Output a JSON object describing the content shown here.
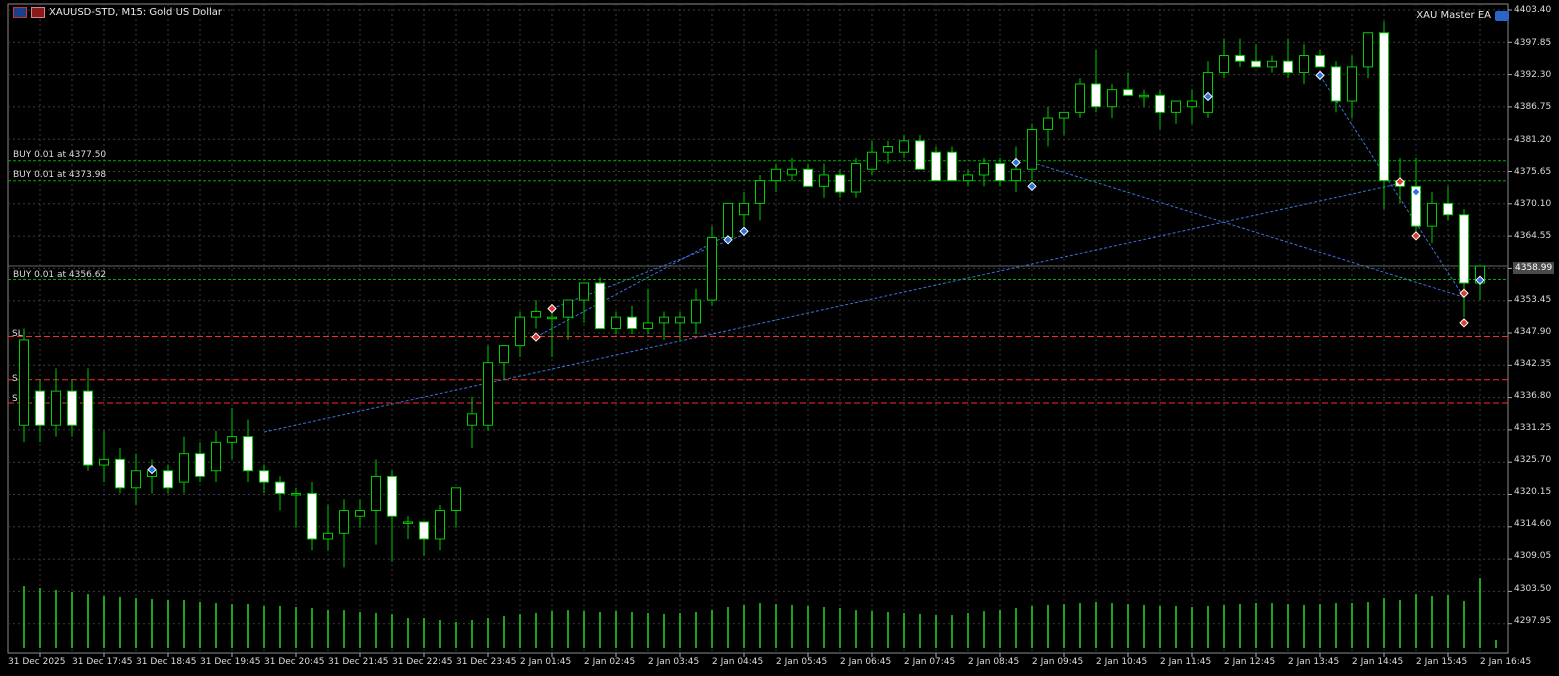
{
  "window": {
    "symbol_title": "XAUUSD-STD, M15:  Gold US Dollar",
    "expert_label": "XAU Master EA",
    "icons": [
      "chart-menu-icon",
      "instrument-icon",
      "expert-cap-icon"
    ]
  },
  "orders": [
    {
      "label": "BUY 0.01 at 4377.50",
      "price": 4377.5
    },
    {
      "label": "BUY 0.01 at 4373.98",
      "price": 4373.98
    },
    {
      "label": "BUY 0.01 at 4356.62",
      "price": 4356.62
    }
  ],
  "sl_markers": [
    {
      "label": "SL",
      "price": 4346.6
    },
    {
      "label": "S",
      "price": 4339.0
    },
    {
      "label": "S",
      "price": 4334.9
    }
  ],
  "current_price": "4358.99",
  "colors": {
    "background": "#000000",
    "grid": "#3d3d3d",
    "bull_candle": "#000000",
    "bear_candle": "#ffffff",
    "wick": "#00cc00",
    "volume": "#22cc22",
    "order_line": "#00aa00",
    "sl_line": "#ff2a2a",
    "trade_line": "#3b73d9"
  },
  "y_axis": [
    "4403.40",
    "4397.85",
    "4392.30",
    "4386.75",
    "4381.20",
    "4375.65",
    "4370.10",
    "4364.55",
    "4358.99",
    "4353.45",
    "4347.90",
    "4342.35",
    "4336.80",
    "4331.25",
    "4325.70",
    "4320.15",
    "4314.60",
    "4309.05",
    "4303.50",
    "4297.95"
  ],
  "x_axis": [
    "31 Dec 2025",
    "31 Dec 17:45",
    "31 Dec 18:45",
    "31 Dec 19:45",
    "31 Dec 20:45",
    "31 Dec 21:45",
    "31 Dec 22:45",
    "31 Dec 23:45",
    "2 Jan 01:45",
    "2 Jan 02:45",
    "2 Jan 03:45",
    "2 Jan 04:45",
    "2 Jan 05:45",
    "2 Jan 06:45",
    "2 Jan 07:45",
    "2 Jan 08:45",
    "2 Jan 09:45",
    "2 Jan 10:45",
    "2 Jan 11:45",
    "2 Jan 12:45",
    "2 Jan 13:45",
    "2 Jan 14:45",
    "2 Jan 15:45",
    "2 Jan 16:45"
  ],
  "chart_data": {
    "type": "candlestick",
    "timeframe": "M15",
    "ylim": [
      4295.0,
      4404.0
    ],
    "candles": [
      {
        "o": 4331,
        "h": 4348,
        "l": 4328,
        "c": 4346
      },
      {
        "o": 4337,
        "h": 4339,
        "l": 4328,
        "c": 4331
      },
      {
        "o": 4331,
        "h": 4341,
        "l": 4329,
        "c": 4337
      },
      {
        "o": 4337,
        "h": 4339,
        "l": 4329,
        "c": 4331
      },
      {
        "o": 4337,
        "h": 4341,
        "l": 4323,
        "c": 4324
      },
      {
        "o": 4324,
        "h": 4330,
        "l": 4321,
        "c": 4325
      },
      {
        "o": 4325,
        "h": 4327,
        "l": 4319,
        "c": 4320
      },
      {
        "o": 4320,
        "h": 4326,
        "l": 4317,
        "c": 4323
      },
      {
        "o": 4322,
        "h": 4325,
        "l": 4319,
        "c": 4323
      },
      {
        "o": 4323,
        "h": 4324,
        "l": 4319,
        "c": 4320
      },
      {
        "o": 4321,
        "h": 4329,
        "l": 4319,
        "c": 4326
      },
      {
        "o": 4326,
        "h": 4328,
        "l": 4321,
        "c": 4322
      },
      {
        "o": 4323,
        "h": 4330,
        "l": 4321,
        "c": 4328
      },
      {
        "o": 4328,
        "h": 4334,
        "l": 4325,
        "c": 4329
      },
      {
        "o": 4329,
        "h": 4332,
        "l": 4321,
        "c": 4323
      },
      {
        "o": 4323,
        "h": 4324,
        "l": 4319,
        "c": 4321
      },
      {
        "o": 4321,
        "h": 4322,
        "l": 4316,
        "c": 4319
      },
      {
        "o": 4319,
        "h": 4320,
        "l": 4313,
        "c": 4319
      },
      {
        "o": 4319,
        "h": 4321,
        "l": 4309,
        "c": 4311
      },
      {
        "o": 4311,
        "h": 4317,
        "l": 4309,
        "c": 4312
      },
      {
        "o": 4312,
        "h": 4318,
        "l": 4306,
        "c": 4316
      },
      {
        "o": 4315,
        "h": 4318,
        "l": 4313,
        "c": 4316
      },
      {
        "o": 4316,
        "h": 4325,
        "l": 4310,
        "c": 4322
      },
      {
        "o": 4322,
        "h": 4323,
        "l": 4307,
        "c": 4315
      },
      {
        "o": 4314,
        "h": 4315,
        "l": 4311,
        "c": 4314
      },
      {
        "o": 4314,
        "h": 4314,
        "l": 4308,
        "c": 4311
      },
      {
        "o": 4311,
        "h": 4317,
        "l": 4309,
        "c": 4316
      },
      {
        "o": 4316,
        "h": 4320,
        "l": 4313,
        "c": 4320
      },
      {
        "o": 4331,
        "h": 4336,
        "l": 4327,
        "c": 4333
      },
      {
        "o": 4331,
        "h": 4345,
        "l": 4330,
        "c": 4342
      },
      {
        "o": 4342,
        "h": 4345,
        "l": 4339,
        "c": 4345
      },
      {
        "o": 4345,
        "h": 4351,
        "l": 4343,
        "c": 4350
      },
      {
        "o": 4350,
        "h": 4353,
        "l": 4348,
        "c": 4351
      },
      {
        "o": 4350,
        "h": 4352,
        "l": 4343,
        "c": 4350
      },
      {
        "o": 4350,
        "h": 4353,
        "l": 4346,
        "c": 4353
      },
      {
        "o": 4353,
        "h": 4356,
        "l": 4349,
        "c": 4356
      },
      {
        "o": 4356,
        "h": 4357,
        "l": 4348,
        "c": 4348
      },
      {
        "o": 4348,
        "h": 4351,
        "l": 4347,
        "c": 4350
      },
      {
        "o": 4350,
        "h": 4352,
        "l": 4347,
        "c": 4348
      },
      {
        "o": 4348,
        "h": 4355,
        "l": 4347,
        "c": 4349
      },
      {
        "o": 4349,
        "h": 4351,
        "l": 4346,
        "c": 4350
      },
      {
        "o": 4349,
        "h": 4351,
        "l": 4346,
        "c": 4350
      },
      {
        "o": 4349,
        "h": 4355,
        "l": 4347,
        "c": 4353
      },
      {
        "o": 4353,
        "h": 4366,
        "l": 4352,
        "c": 4364
      },
      {
        "o": 4364,
        "h": 4368,
        "l": 4363,
        "c": 4370
      },
      {
        "o": 4368,
        "h": 4372,
        "l": 4366,
        "c": 4370
      },
      {
        "o": 4370,
        "h": 4375,
        "l": 4367,
        "c": 4374
      },
      {
        "o": 4374,
        "h": 4377,
        "l": 4372,
        "c": 4376
      },
      {
        "o": 4375,
        "h": 4378,
        "l": 4374,
        "c": 4376
      },
      {
        "o": 4376,
        "h": 4377,
        "l": 4373,
        "c": 4373
      },
      {
        "o": 4373,
        "h": 4377,
        "l": 4371,
        "c": 4375
      },
      {
        "o": 4375,
        "h": 4376,
        "l": 4371,
        "c": 4372
      },
      {
        "o": 4372,
        "h": 4378,
        "l": 4371,
        "c": 4377
      },
      {
        "o": 4376,
        "h": 4381,
        "l": 4375,
        "c": 4379
      },
      {
        "o": 4379,
        "h": 4381,
        "l": 4377,
        "c": 4380
      },
      {
        "o": 4379,
        "h": 4382,
        "l": 4378,
        "c": 4381
      },
      {
        "o": 4381,
        "h": 4382,
        "l": 4376,
        "c": 4376
      },
      {
        "o": 4379,
        "h": 4380,
        "l": 4374,
        "c": 4374
      },
      {
        "o": 4379,
        "h": 4380,
        "l": 4374,
        "c": 4374
      },
      {
        "o": 4374,
        "h": 4376,
        "l": 4373,
        "c": 4375
      },
      {
        "o": 4375,
        "h": 4378,
        "l": 4373,
        "c": 4377
      },
      {
        "o": 4377,
        "h": 4378,
        "l": 4373,
        "c": 4374
      },
      {
        "o": 4374,
        "h": 4380,
        "l": 4372,
        "c": 4376
      },
      {
        "o": 4376,
        "h": 4384,
        "l": 4374,
        "c": 4383
      },
      {
        "o": 4383,
        "h": 4387,
        "l": 4380,
        "c": 4385
      },
      {
        "o": 4385,
        "h": 4386,
        "l": 4382,
        "c": 4386
      },
      {
        "o": 4386,
        "h": 4392,
        "l": 4385,
        "c": 4391
      },
      {
        "o": 4391,
        "h": 4397,
        "l": 4386,
        "c": 4387
      },
      {
        "o": 4387,
        "h": 4391,
        "l": 4385,
        "c": 4390
      },
      {
        "o": 4390,
        "h": 4393,
        "l": 4389,
        "c": 4389
      },
      {
        "o": 4389,
        "h": 4390,
        "l": 4387,
        "c": 4389
      },
      {
        "o": 4389,
        "h": 4390,
        "l": 4383,
        "c": 4386
      },
      {
        "o": 4386,
        "h": 4388,
        "l": 4384,
        "c": 4388
      },
      {
        "o": 4387,
        "h": 4390,
        "l": 4384,
        "c": 4388
      },
      {
        "o": 4386,
        "h": 4395,
        "l": 4385,
        "c": 4393
      },
      {
        "o": 4393,
        "h": 4399,
        "l": 4392,
        "c": 4396
      },
      {
        "o": 4396,
        "h": 4399,
        "l": 4394,
        "c": 4395
      },
      {
        "o": 4395,
        "h": 4398,
        "l": 4394,
        "c": 4394
      },
      {
        "o": 4394,
        "h": 4396,
        "l": 4393,
        "c": 4395
      },
      {
        "o": 4395,
        "h": 4399,
        "l": 4392,
        "c": 4393
      },
      {
        "o": 4393,
        "h": 4398,
        "l": 4391,
        "c": 4396
      },
      {
        "o": 4396,
        "h": 4397,
        "l": 4394,
        "c": 4394
      },
      {
        "o": 4394,
        "h": 4395,
        "l": 4386,
        "c": 4388
      },
      {
        "o": 4388,
        "h": 4396,
        "l": 4385,
        "c": 4394
      },
      {
        "o": 4394,
        "h": 4400,
        "l": 4392,
        "c": 4400
      },
      {
        "o": 4400,
        "h": 4402,
        "l": 4369,
        "c": 4374
      },
      {
        "o": 4374,
        "h": 4378,
        "l": 4370,
        "c": 4373
      },
      {
        "o": 4373,
        "h": 4378,
        "l": 4364,
        "c": 4366
      },
      {
        "o": 4366,
        "h": 4372,
        "l": 4363,
        "c": 4370
      },
      {
        "o": 4370,
        "h": 4373,
        "l": 4367,
        "c": 4368
      },
      {
        "o": 4368,
        "h": 4369,
        "l": 4350,
        "c": 4356
      },
      {
        "o": 4356,
        "h": 4359,
        "l": 4353,
        "c": 4358.99
      }
    ],
    "volume": [
      62,
      60,
      58,
      56,
      54,
      52,
      51,
      50,
      49,
      48,
      48,
      46,
      45,
      44,
      44,
      42,
      42,
      41,
      40,
      38,
      38,
      36,
      35,
      34,
      30,
      30,
      28,
      26,
      28,
      30,
      32,
      34,
      35,
      37,
      38,
      37,
      36,
      37,
      36,
      35,
      34,
      35,
      36,
      38,
      41,
      43,
      45,
      44,
      43,
      42,
      41,
      40,
      38,
      37,
      36,
      35,
      34,
      33,
      33,
      35,
      37,
      38,
      40,
      42,
      43,
      44,
      45,
      46,
      45,
      44,
      43,
      42,
      42,
      41,
      42,
      43,
      44,
      45,
      45,
      44,
      43,
      44,
      45,
      45,
      46,
      50,
      48,
      54,
      52,
      53,
      47,
      70,
      8
    ],
    "markers": [
      {
        "i": 8,
        "price": 4323.2,
        "type": "buy"
      },
      {
        "i": 32,
        "price": 4346.5,
        "type": "sell"
      },
      {
        "i": 33,
        "price": 4351.5,
        "type": "sell"
      },
      {
        "i": 44,
        "price": 4363.6,
        "type": "buy"
      },
      {
        "i": 45,
        "price": 4365.1,
        "type": "buy"
      },
      {
        "i": 62,
        "price": 4377.2,
        "type": "buy"
      },
      {
        "i": 63,
        "price": 4373.0,
        "type": "buy"
      },
      {
        "i": 74,
        "price": 4388.8,
        "type": "buy"
      },
      {
        "i": 81,
        "price": 4392.5,
        "type": "buy"
      },
      {
        "i": 86,
        "price": 4373.8,
        "type": "sell"
      },
      {
        "i": 87,
        "price": 4372.0,
        "type": "buy"
      },
      {
        "i": 87,
        "price": 4364.3,
        "type": "sell"
      },
      {
        "i": 90,
        "price": 4354.2,
        "type": "sell"
      },
      {
        "i": 90,
        "price": 4349.0,
        "type": "sell"
      },
      {
        "i": 91,
        "price": 4356.5,
        "type": "buy"
      }
    ],
    "trade_lines": [
      {
        "from": [
          15,
          4329.8
        ],
        "to": [
          86,
          4373.5
        ]
      },
      {
        "from": [
          63,
          4377.2
        ],
        "to": [
          90,
          4353.5
        ]
      },
      {
        "from": [
          81,
          4392.5
        ],
        "to": [
          90,
          4353.5
        ]
      },
      {
        "from": [
          32,
          4346.5
        ],
        "to": [
          44,
          4364.5
        ]
      },
      {
        "from": [
          33,
          4351.5
        ],
        "to": [
          45,
          4364.5
        ]
      }
    ]
  }
}
